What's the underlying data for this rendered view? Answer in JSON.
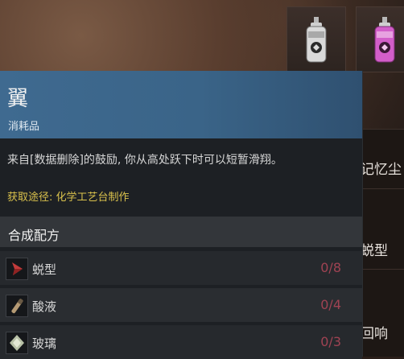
{
  "item": {
    "name": "翼",
    "category": "消耗品",
    "description": "来自[数据删除]的鼓励, 你从高处跃下时可以短暂滑翔。",
    "source": "获取途径: 化学工艺台制作"
  },
  "recipe": {
    "title": "合成配方",
    "ingredients": [
      {
        "name": "蜕型",
        "count": "0/8",
        "icon": "red-crystal-icon"
      },
      {
        "name": "酸液",
        "count": "0/4",
        "icon": "vial-icon"
      },
      {
        "name": "玻璃",
        "count": "0/3",
        "icon": "glass-shard-icon"
      }
    ]
  },
  "right_list": [
    "记忆尘",
    "蜕型",
    "回响"
  ],
  "colors": {
    "header_blue": "#3f6a90",
    "source_yellow": "#d9c14c",
    "count_red": "#a04353"
  }
}
